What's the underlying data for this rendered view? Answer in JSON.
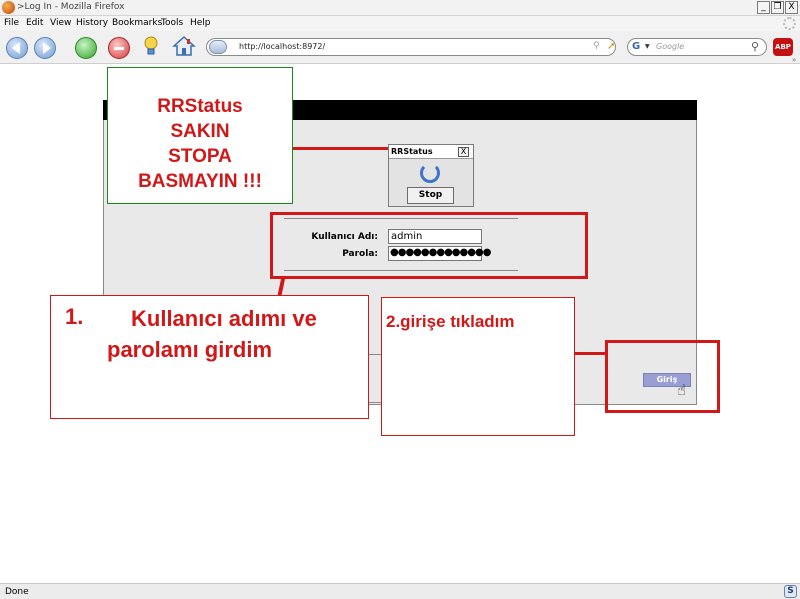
{
  "window": {
    "title": ">Log In - Mozilla Firefox",
    "minimize": "_",
    "maximize": "❐",
    "close": "X"
  },
  "menu": [
    "File",
    "Edit",
    "View",
    "History",
    "Bookmarks",
    "Tools",
    "Help"
  ],
  "navbar": {
    "url": "http://localhost:8972/",
    "search_engine": "G",
    "search_placeholder": "Google",
    "adblock_label": "ABP"
  },
  "callouts": {
    "rrstatus": [
      "RRStatus",
      "SAKIN",
      "STOPA",
      "BASMAYIN !!!"
    ],
    "step1_number": "1.",
    "step1_line1": "Kullanıcı adımı ve",
    "step1_line2": "parolamı girdim",
    "step2": "2.girişe tıkladım"
  },
  "rrstatus_window": {
    "title": "RRStatus",
    "close": "X",
    "stop_label": "Stop"
  },
  "login": {
    "username_label": "Kullanıcı Adı:",
    "username_value": "admin",
    "password_label": "Parola:",
    "password_value": "●●●●●●●●●●●●●",
    "submit_label": "Giriş"
  },
  "status": {
    "text": "Done",
    "icon": "S"
  },
  "colors": {
    "annotation_red": "#d01818",
    "annotation_green": "#1a8a1a",
    "giris_button": "#9a9fd3"
  }
}
